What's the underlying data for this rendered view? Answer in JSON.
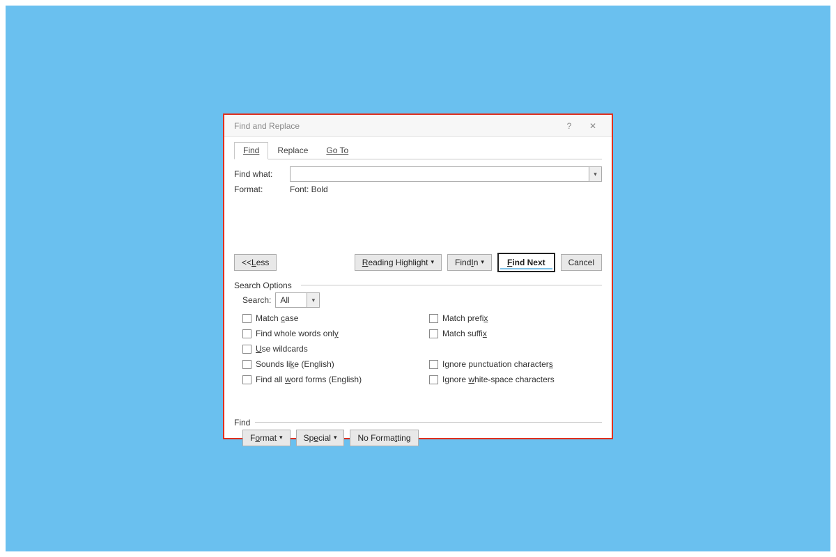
{
  "dialog": {
    "title": "Find and Replace",
    "help_symbol": "?",
    "close_symbol": "✕"
  },
  "tabs": {
    "find": "Find",
    "replace": "Replace",
    "goto": "Go To"
  },
  "find_what_label": "Find what:",
  "format_label": "Format:",
  "format_value": "Font: Bold",
  "buttons": {
    "less_pre": "<< ",
    "less_u": "L",
    "less_post": "ess",
    "reading_pre": "",
    "reading_u": "R",
    "reading_post": "eading Highlight",
    "findin_pre": "Find ",
    "findin_u": "I",
    "findin_post": "n",
    "findnext_pre": "",
    "findnext_u": "F",
    "findnext_post": "ind Next",
    "cancel": "Cancel"
  },
  "search_options_legend": "Search Options",
  "search_label": "Search:",
  "search_value": "All",
  "checks": {
    "match_case_pre": "Match ",
    "match_case_u": "c",
    "match_case_post": "ase",
    "whole_pre": "Find whole words onl",
    "whole_u": "y",
    "whole_post": "",
    "wild_pre": "",
    "wild_u": "U",
    "wild_post": "se wildcards",
    "sounds_pre": "Sounds li",
    "sounds_u": "k",
    "sounds_post": "e (English)",
    "allforms_pre": "Find all ",
    "allforms_u": "w",
    "allforms_post": "ord forms (English)",
    "prefix_pre": "Match prefi",
    "prefix_u": "x",
    "prefix_post": "",
    "suffix_pre": "Match suffi",
    "suffix_u": "x",
    "suffix_post": "",
    "ignorepunc_pre": "Ignore punctuation character",
    "ignorepunc_u": "s",
    "ignorepunc_post": "",
    "ignorews_pre": "Ignore ",
    "ignorews_u": "w",
    "ignorews_post": "hite-space characters"
  },
  "find_legend": "Find",
  "footer": {
    "format_pre": "F",
    "format_u": "o",
    "format_post": "rmat",
    "special_pre": "Sp",
    "special_u": "e",
    "special_post": "cial",
    "noformat_pre": "No Forma",
    "noformat_u": "t",
    "noformat_post": "ting"
  }
}
